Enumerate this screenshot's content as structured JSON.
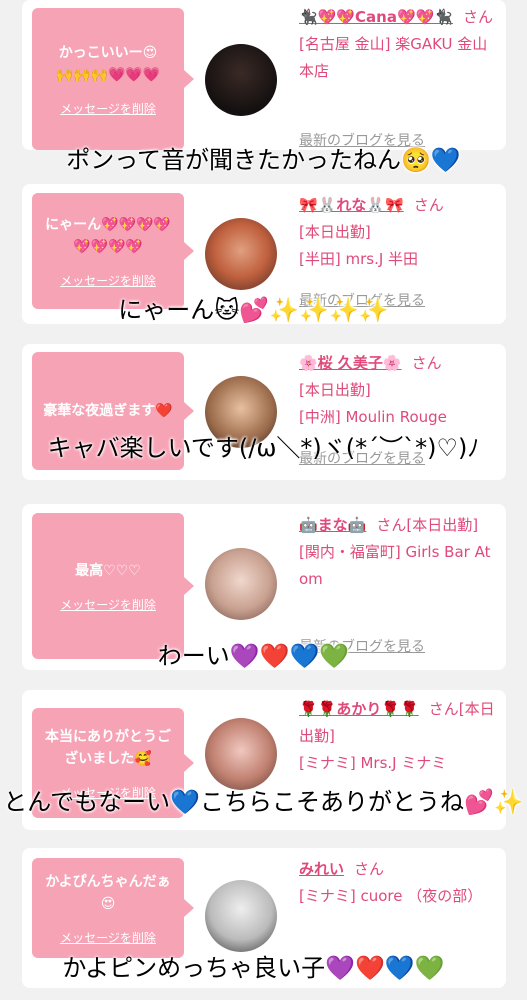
{
  "entries": [
    {
      "message": "かっこいいー😍\n🙌🙌🙌💗💗💗",
      "delete_label": "メッセージを削除",
      "name": "🐈‍⬛💖💖Cana💖💖🐈‍⬛",
      "san": "さん",
      "shop": "[名古屋 金山] 楽GAKU 金山本店",
      "blog_label": "最新のブログを見る",
      "caption": "ポンって音が聞きたかったねん🥺💙"
    },
    {
      "message": "にゃーん💖💖💖💖💖💖💖💖",
      "delete_label": "メッセージを削除",
      "name": "🎀🐰れな🐰🎀",
      "san": "さん",
      "shop": "[本日出勤]\n[半田] mrs.J 半田",
      "blog_label": "最新のブログを見る",
      "caption": "にゃーん🐱💕✨✨✨✨"
    },
    {
      "message": "豪華な夜過ぎます❤️",
      "delete_label": "",
      "name": "🌸桜 久美子🌸",
      "san": "さん",
      "shop": "[本日出勤]\n[中洲] Moulin Rouge",
      "blog_label": "最新のブログを見る",
      "caption": "キャバ楽しいです(/ω＼*)ヾ(*´︶`*)♡)ﾉ"
    },
    {
      "message": "最高♡♡♡",
      "delete_label": "メッセージを削除",
      "name": "🤖まな🤖",
      "san": "さん[本日出勤]",
      "shop": "[関内・福富町] Girls Bar Atom",
      "blog_label": "最新のブログを見る",
      "caption": "わーい💜❤️💙💚"
    },
    {
      "message": "本当にありがとうございました🥰",
      "delete_label": "メッセージを削除",
      "name": "🌹🌹あかり🌹🌹",
      "san": "さん[本日出勤]",
      "shop": "[ミナミ] Mrs.J ミナミ",
      "blog_label": "",
      "caption": "とんでもなーい💙こちらこそありがとうね💕✨"
    },
    {
      "message": "かよぴんちゃんだぁ😍",
      "delete_label": "メッセージを削除",
      "name": "みれい",
      "san": "さん",
      "shop": "[ミナミ] cuore （夜の部）",
      "blog_label": "",
      "caption": "かよピンめっちゃ良い子💜❤️💙💚"
    }
  ],
  "colors": {
    "accent": "#e04a7a",
    "bubble": "#f7a3b6",
    "background": "#f1f1f1"
  }
}
